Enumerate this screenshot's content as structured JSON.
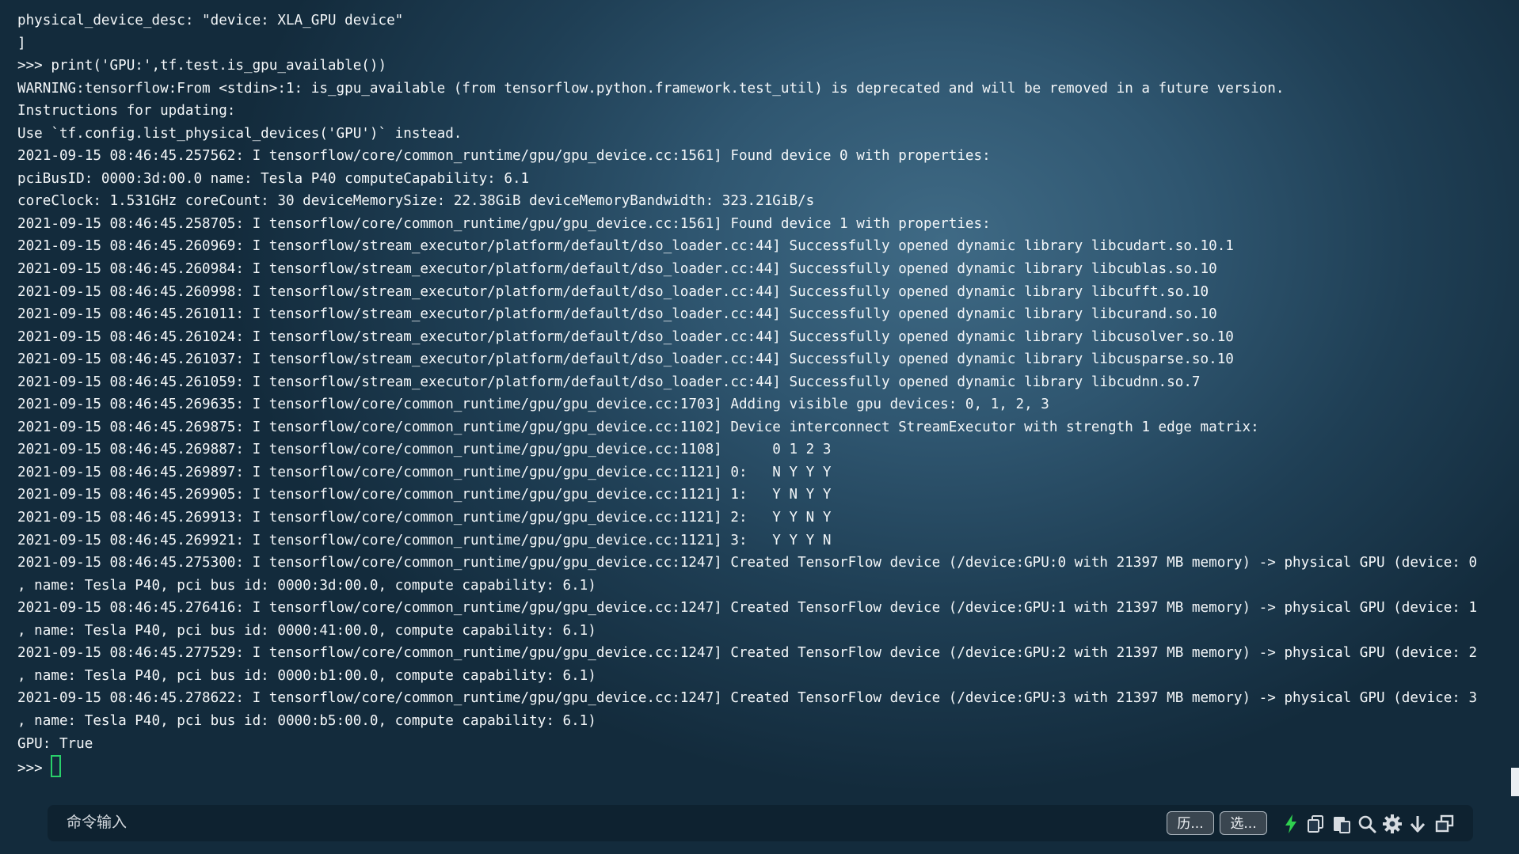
{
  "terminal": {
    "lines": [
      "physical_device_desc: \"device: XLA_GPU device\"",
      "]",
      ">>> print('GPU:',tf.test.is_gpu_available())",
      "WARNING:tensorflow:From <stdin>:1: is_gpu_available (from tensorflow.python.framework.test_util) is deprecated and will be removed in a future version.",
      "Instructions for updating:",
      "Use `tf.config.list_physical_devices('GPU')` instead.",
      "2021-09-15 08:46:45.257562: I tensorflow/core/common_runtime/gpu/gpu_device.cc:1561] Found device 0 with properties:",
      "pciBusID: 0000:3d:00.0 name: Tesla P40 computeCapability: 6.1",
      "coreClock: 1.531GHz coreCount: 30 deviceMemorySize: 22.38GiB deviceMemoryBandwidth: 323.21GiB/s",
      "2021-09-15 08:46:45.258705: I tensorflow/core/common_runtime/gpu/gpu_device.cc:1561] Found device 1 with properties:",
      "2021-09-15 08:46:45.260969: I tensorflow/stream_executor/platform/default/dso_loader.cc:44] Successfully opened dynamic library libcudart.so.10.1",
      "2021-09-15 08:46:45.260984: I tensorflow/stream_executor/platform/default/dso_loader.cc:44] Successfully opened dynamic library libcublas.so.10",
      "2021-09-15 08:46:45.260998: I tensorflow/stream_executor/platform/default/dso_loader.cc:44] Successfully opened dynamic library libcufft.so.10",
      "2021-09-15 08:46:45.261011: I tensorflow/stream_executor/platform/default/dso_loader.cc:44] Successfully opened dynamic library libcurand.so.10",
      "2021-09-15 08:46:45.261024: I tensorflow/stream_executor/platform/default/dso_loader.cc:44] Successfully opened dynamic library libcusolver.so.10",
      "2021-09-15 08:46:45.261037: I tensorflow/stream_executor/platform/default/dso_loader.cc:44] Successfully opened dynamic library libcusparse.so.10",
      "2021-09-15 08:46:45.261059: I tensorflow/stream_executor/platform/default/dso_loader.cc:44] Successfully opened dynamic library libcudnn.so.7",
      "2021-09-15 08:46:45.269635: I tensorflow/core/common_runtime/gpu/gpu_device.cc:1703] Adding visible gpu devices: 0, 1, 2, 3",
      "2021-09-15 08:46:45.269875: I tensorflow/core/common_runtime/gpu/gpu_device.cc:1102] Device interconnect StreamExecutor with strength 1 edge matrix:",
      "2021-09-15 08:46:45.269887: I tensorflow/core/common_runtime/gpu/gpu_device.cc:1108]      0 1 2 3",
      "2021-09-15 08:46:45.269897: I tensorflow/core/common_runtime/gpu/gpu_device.cc:1121] 0:   N Y Y Y",
      "2021-09-15 08:46:45.269905: I tensorflow/core/common_runtime/gpu/gpu_device.cc:1121] 1:   Y N Y Y",
      "2021-09-15 08:46:45.269913: I tensorflow/core/common_runtime/gpu/gpu_device.cc:1121] 2:   Y Y N Y",
      "2021-09-15 08:46:45.269921: I tensorflow/core/common_runtime/gpu/gpu_device.cc:1121] 3:   Y Y Y N",
      "2021-09-15 08:46:45.275300: I tensorflow/core/common_runtime/gpu/gpu_device.cc:1247] Created TensorFlow device (/device:GPU:0 with 21397 MB memory) -> physical GPU (device: 0",
      ", name: Tesla P40, pci bus id: 0000:3d:00.0, compute capability: 6.1)",
      "2021-09-15 08:46:45.276416: I tensorflow/core/common_runtime/gpu/gpu_device.cc:1247] Created TensorFlow device (/device:GPU:1 with 21397 MB memory) -> physical GPU (device: 1",
      ", name: Tesla P40, pci bus id: 0000:41:00.0, compute capability: 6.1)",
      "2021-09-15 08:46:45.277529: I tensorflow/core/common_runtime/gpu/gpu_device.cc:1247] Created TensorFlow device (/device:GPU:2 with 21397 MB memory) -> physical GPU (device: 2",
      ", name: Tesla P40, pci bus id: 0000:b1:00.0, compute capability: 6.1)",
      "2021-09-15 08:46:45.278622: I tensorflow/core/common_runtime/gpu/gpu_device.cc:1247] Created TensorFlow device (/device:GPU:3 with 21397 MB memory) -> physical GPU (device: 3",
      ", name: Tesla P40, pci bus id: 0000:b5:00.0, compute capability: 6.1)",
      "GPU: True"
    ],
    "prompt": ">>>"
  },
  "command_bar": {
    "input_placeholder": "命令输入",
    "history_label": "历...",
    "options_label": "选...",
    "icons": [
      "lightning-icon",
      "copy-icon",
      "paste-icon",
      "search-icon",
      "gear-icon",
      "download-icon",
      "restore-window-icon"
    ]
  },
  "colors": {
    "cursor": "#29d06a",
    "lightning": "#2fd04f",
    "text": "#f4f7f9"
  }
}
